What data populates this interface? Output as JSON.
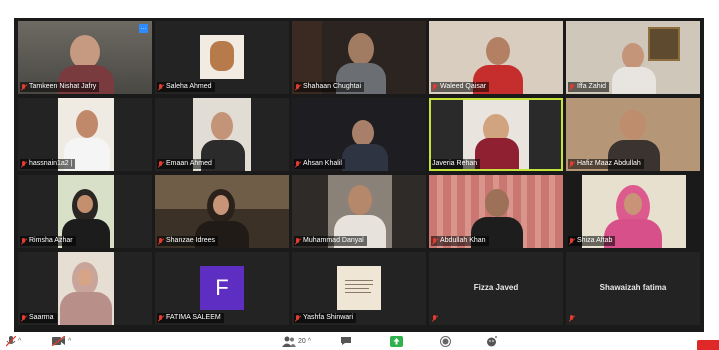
{
  "participants": [
    {
      "name": "Tamkeen Nishat Jafry"
    },
    {
      "name": "Saleha Ahmed"
    },
    {
      "name": "Shahaan Chughtai"
    },
    {
      "name": "Waleed Qaisar"
    },
    {
      "name": "Iffa Zahid"
    },
    {
      "name": "hassnain1a2 |"
    },
    {
      "name": "Emaan Ahmed"
    },
    {
      "name": "Ahsan Khalil"
    },
    {
      "name": "Javeria Rehan"
    },
    {
      "name": "Hafiz Maaz Abdullah"
    },
    {
      "name": "Rimsha Azhar"
    },
    {
      "name": "Shanzae Idrees"
    },
    {
      "name": "Muhammad Danyal"
    },
    {
      "name": "Abdullah Khan"
    },
    {
      "name": "Shiza Aftab"
    },
    {
      "name": "Saarma"
    },
    {
      "name": "FATIMA SALEEM",
      "initial": "F"
    },
    {
      "name": "Yashfa Shinwari"
    },
    {
      "name": "Fizza Javed"
    },
    {
      "name": "Shawaizah fatima"
    }
  ],
  "toolbar": {
    "participants_count": "20"
  },
  "colors": {
    "speaking_border": "#c6e33a",
    "muted_mic": "#e43b30",
    "avatar_purple": "#5d2ec1",
    "leave": "#e02828"
  },
  "icons": [
    "mic-muted-icon",
    "video-off-icon",
    "participants-icon",
    "chat-icon",
    "share-screen-icon",
    "record-icon",
    "reactions-icon",
    "more-options-icon"
  ]
}
